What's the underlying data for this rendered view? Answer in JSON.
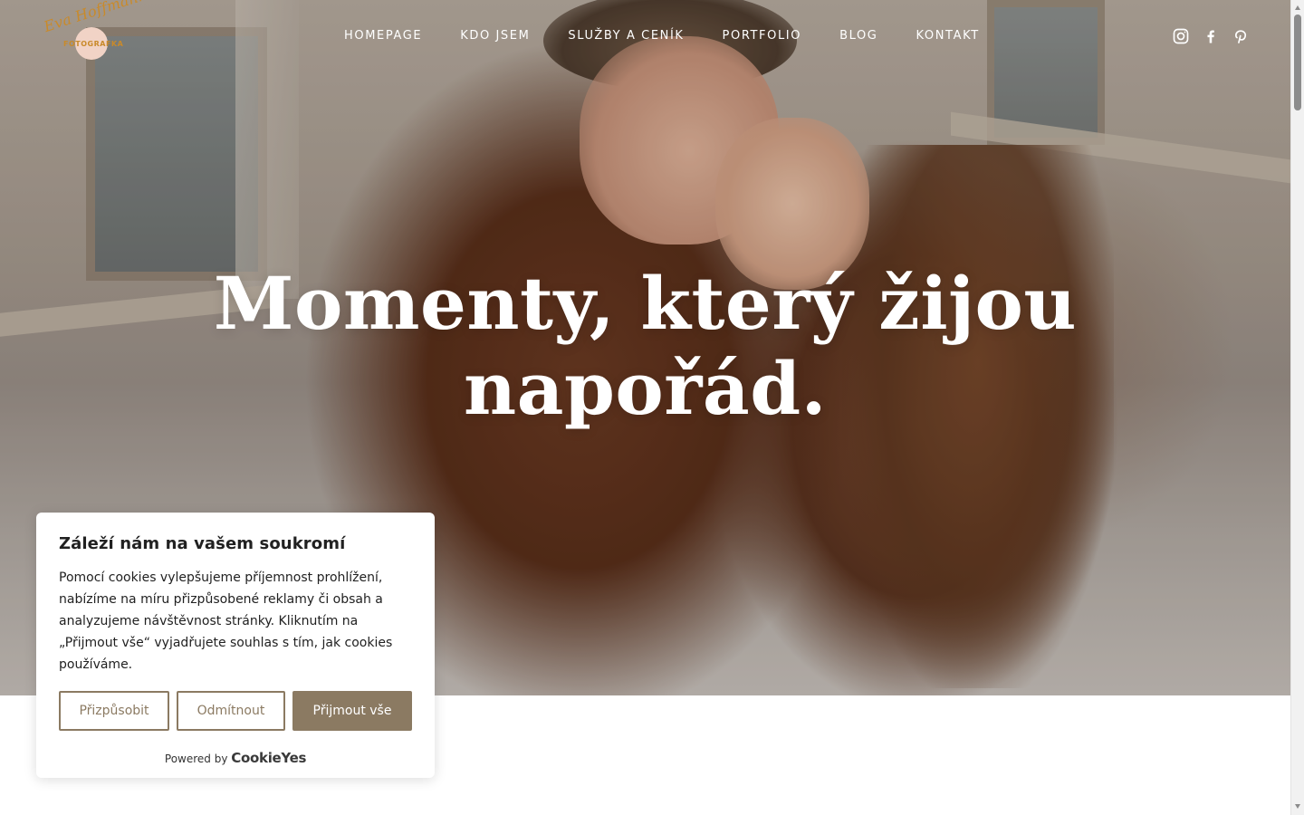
{
  "brand": {
    "name": "Eva Hoffmann",
    "subtitle": "FOTOGRAFKA",
    "accent": "#c98a2a"
  },
  "nav": {
    "items": [
      {
        "label": "HOMEPAGE"
      },
      {
        "label": "KDO JSEM"
      },
      {
        "label": "SLUŽBY A CENÍK"
      },
      {
        "label": "PORTFOLIO"
      },
      {
        "label": "BLOG"
      },
      {
        "label": "KONTAKT"
      }
    ]
  },
  "social": {
    "icons": [
      "instagram-icon",
      "facebook-icon",
      "pinterest-icon"
    ]
  },
  "hero": {
    "headline_line1": "Momenty, který žijou",
    "headline_line2": "napořád."
  },
  "cookie": {
    "title": "Záleží nám na vašem soukromí",
    "text": "Pomocí cookies vylepšujeme příjemnost prohlížení, nabízíme na míru přizpůsobené reklamy či obsah a analyzujeme návštěvnost stránky. Kliknutím na „Přijmout vše“ vyjadřujete souhlas s tím, jak cookies používáme.",
    "customize_label": "Přizpůsobit",
    "reject_label": "Odmítnout",
    "accept_label": "Přijmout vše",
    "powered_by": "Powered by",
    "powered_brand": "CookieYes",
    "button_color": "#8b7a62"
  }
}
